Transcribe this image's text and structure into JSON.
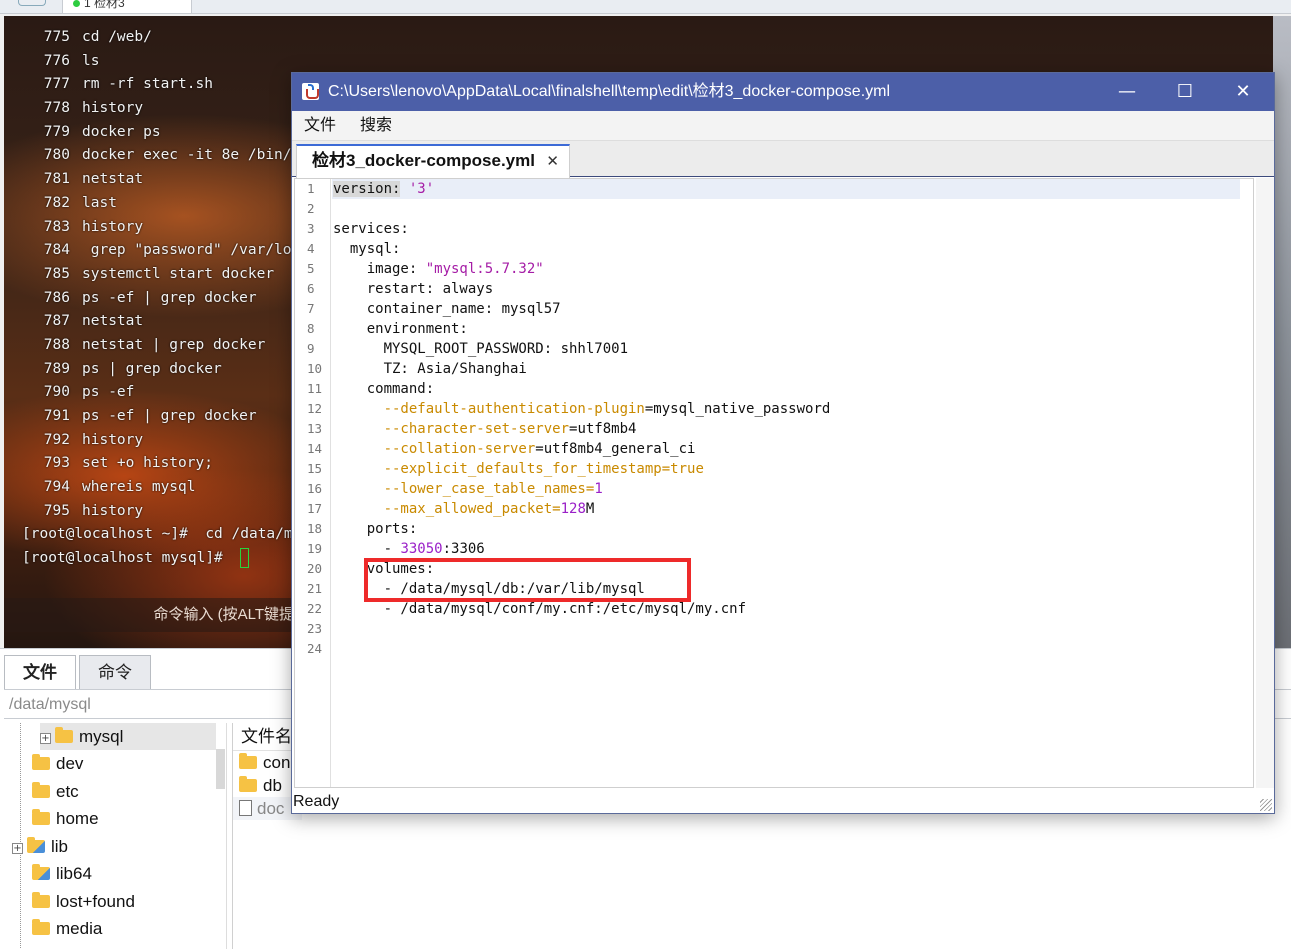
{
  "host": {
    "top_tab_label": "1 检材3",
    "terminal_lines": [
      {
        "num": "775",
        "text": "cd /web/"
      },
      {
        "num": "776",
        "text": "ls"
      },
      {
        "num": "777",
        "text": "rm -rf start.sh"
      },
      {
        "num": "778",
        "text": "history"
      },
      {
        "num": "779",
        "text": "docker ps"
      },
      {
        "num": "780",
        "text": "docker exec -it 8e /bin/"
      },
      {
        "num": "781",
        "text": "netstat"
      },
      {
        "num": "782",
        "text": "last"
      },
      {
        "num": "783",
        "text": "history"
      },
      {
        "num": "784",
        "text": " grep \"password\" /var/lo"
      },
      {
        "num": "785",
        "text": "systemctl start docker"
      },
      {
        "num": "786",
        "text": "ps -ef | grep docker"
      },
      {
        "num": "787",
        "text": "netstat"
      },
      {
        "num": "788",
        "text": "netstat | grep docker"
      },
      {
        "num": "789",
        "text": "ps | grep docker"
      },
      {
        "num": "790",
        "text": "ps -ef"
      },
      {
        "num": "791",
        "text": "ps -ef | grep docker"
      },
      {
        "num": "792",
        "text": "history"
      },
      {
        "num": "793",
        "text": "set +o history;"
      },
      {
        "num": "794",
        "text": "whereis mysql"
      },
      {
        "num": "795",
        "text": "history"
      }
    ],
    "prompt_lines": [
      "[root@localhost ~]#  cd /data/m",
      "[root@localhost mysql]# "
    ],
    "command_hint": "命令输入 (按ALT键提",
    "file_tabs": [
      "文件",
      "命令"
    ],
    "path": "/data/mysql",
    "tree": [
      "mysql",
      "dev",
      "etc",
      "home",
      "lib",
      "lib64",
      "lost+found",
      "media"
    ],
    "list_header": "文件名",
    "list_items": [
      "con",
      "db",
      "doc"
    ]
  },
  "editor": {
    "title": "C:\\Users\\lenovo\\AppData\\Local\\finalshell\\temp\\edit\\检材3_docker-compose.yml",
    "window_buttons": {
      "minimize": "—",
      "maximize": "☐",
      "close": "✕"
    },
    "menu": [
      "文件",
      "搜索"
    ],
    "tab_label": "检材3_docker-compose.yml",
    "tab_close": "✕",
    "line_numbers": [
      "1",
      "2",
      "3",
      "4",
      "5",
      "6",
      "7",
      "8",
      "9",
      "10",
      "11",
      "12",
      "13",
      "14",
      "15",
      "16",
      "17",
      "18",
      "19",
      "20",
      "21",
      "22",
      "23",
      "24"
    ],
    "code": {
      "l1_key": "version:",
      "l1_val": " '3'",
      "l3": "services:",
      "l4": "  mysql:",
      "l5_key": "    image: ",
      "l5_val": "\"mysql:5.7.32\"",
      "l6": "    restart: always",
      "l7": "    container_name: mysql57",
      "l8": "    environment:",
      "l9": "      MYSQL_ROOT_PASSWORD: shhl7001",
      "l10": "      TZ: Asia/Shanghai",
      "l11": "    command:",
      "l12_opt": "      --default-authentication-plugin",
      "l12_val": "=mysql_native_password",
      "l13_opt": "      --character-set-server",
      "l13_val": "=utf8mb4",
      "l14_opt": "      --collation-server",
      "l14_val": "=utf8mb4_general_ci",
      "l15_opt": "      --explicit_defaults_for_timestamp",
      "l15_val": "=true",
      "l16_opt": "      --lower_case_table_names",
      "l16_eq": "=",
      "l16_num": "1",
      "l17_opt": "      --max_allowed_packet",
      "l17_eq": "=",
      "l17_num": "128",
      "l17_unit": "M",
      "l18": "    ports:",
      "l19_dash": "      - ",
      "l19_num": "33050",
      "l19_rest": ":3306",
      "l20": "    volumes:",
      "l21": "      - /data/mysql/db:/var/lib/mysql",
      "l22": "      - /data/mysql/conf/my.cnf:/etc/mysql/my.cnf"
    },
    "status": "Ready"
  },
  "colors": {
    "title_bar": "#4c5fa8",
    "string": "#a51ca6",
    "option": "#c98a00",
    "number": "#9a20c8",
    "highlight_box": "#ee2a2a",
    "cursor": "#27d43c"
  },
  "icons": [
    "java-app-icon",
    "folder-icon",
    "file-icon",
    "expand-icon"
  ]
}
